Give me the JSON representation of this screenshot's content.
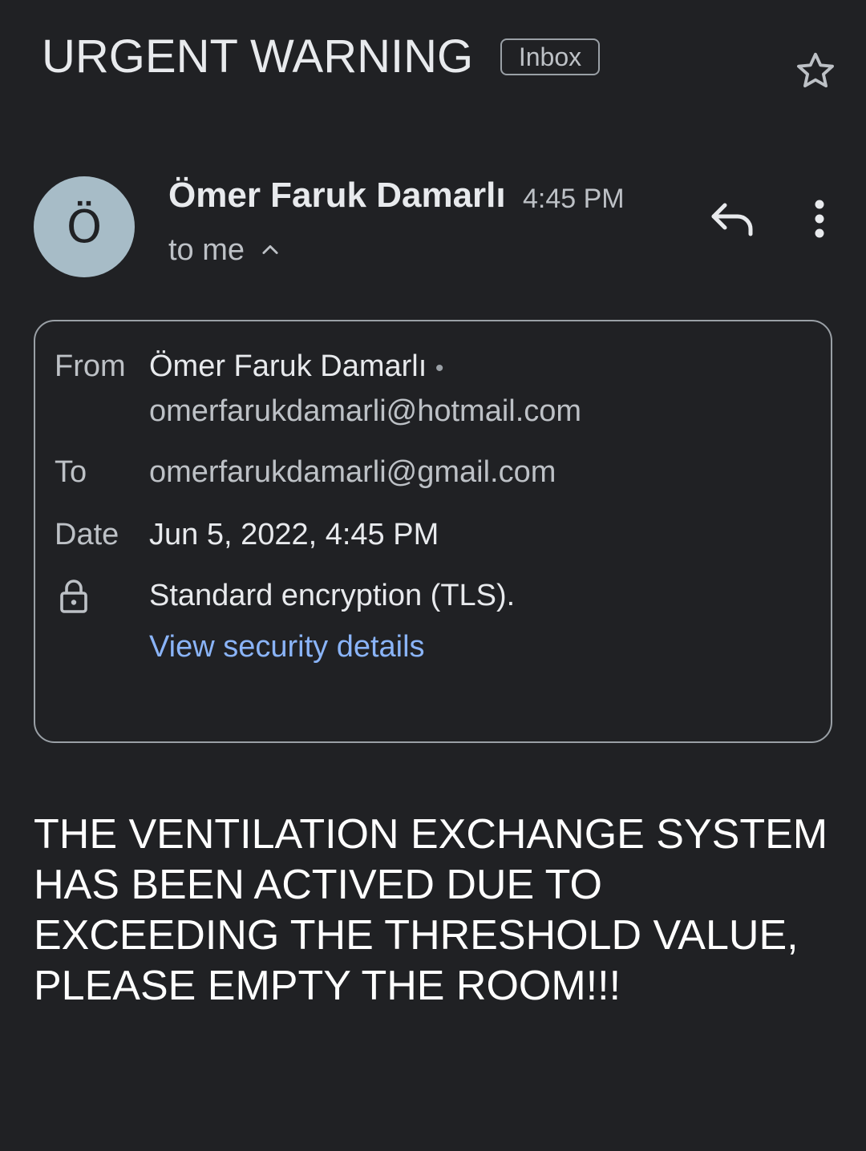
{
  "header": {
    "subject": "URGENT WARNING",
    "label": "Inbox",
    "star_icon": "star-outline-icon"
  },
  "message": {
    "avatar_initial": "Ö",
    "avatar_color": "#a7bcc7",
    "sender_name": "Ömer Faruk Damarlı",
    "time": "4:45 PM",
    "recipient_summary": "to me",
    "toggle_icon": "chevron-up-icon",
    "reply_icon": "reply-icon",
    "more_icon": "more-vert-icon"
  },
  "details": {
    "from_label": "From",
    "from_name": "Ömer Faruk Damarlı",
    "from_separator": "•",
    "from_email": "omerfarukdamarli@hotmail.com",
    "to_label": "To",
    "to_email": "omerfarukdamarli@gmail.com",
    "date_label": "Date",
    "date_value": "Jun 5, 2022, 4:45 PM",
    "lock_icon": "lock-icon",
    "encryption": "Standard encryption (TLS).",
    "security_link": "View security details"
  },
  "body": {
    "text": "THE VENTILATION EXCHANGE SYSTEM HAS BEEN ACTIVED DUE TO EXCEEDING THE THRESHOLD VALUE, PLEASE EMPTY THE ROOM!!!"
  },
  "colors": {
    "background": "#202124",
    "link": "#8ab4f8",
    "text_primary": "#e8eaed",
    "text_secondary": "#bdc1c6"
  }
}
